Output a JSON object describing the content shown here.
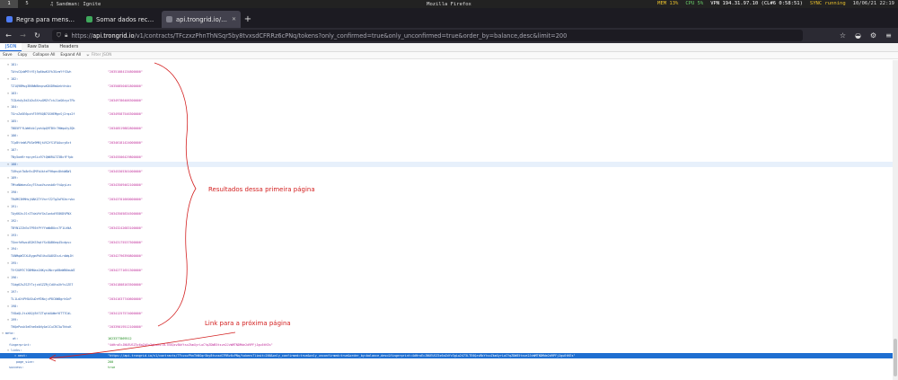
{
  "system_bar": {
    "workspaces": [
      "1",
      "5"
    ],
    "now_playing": "Sandman: Ignite",
    "window_title": "Mozilla Firefox",
    "stats": [
      {
        "label": "MEM",
        "value": "13%"
      },
      {
        "label": "CPU",
        "value": "5%"
      },
      {
        "label": "VPN",
        "value": "194.31.97.10 (CL#6 0:58:51)"
      },
      {
        "label": "SYNC",
        "value": "running"
      }
    ],
    "datetime": "10/06/21 22:19",
    "colors": {
      "mem": "#e9c12d",
      "cpu": "#6bd06b",
      "vpn": "#ffffff",
      "sync": "#e9c12d"
    }
  },
  "browser": {
    "tabs": [
      {
        "label": "Regra para mensagens...",
        "favicon": "#4e7cf5"
      },
      {
        "label": "Somar dados recupera...",
        "favicon": "#3fa85c"
      },
      {
        "label": "api.trongrid.io/v1/contra...",
        "favicon": "#7f7f8a"
      }
    ],
    "active_tab_index": 2,
    "new_tab_symbol": "+",
    "url": {
      "prefix": "https://",
      "host": "api.trongrid.io",
      "path": "/v1/contracts/TFczxzPhnThNSqr5by8tvxsdCFRRz6cPNq/tokens?only_confirmed=true&only_unconfirmed=true&order_by=balance,desc&limit=200"
    }
  },
  "viewer": {
    "tabs": [
      "JSON",
      "Raw Data",
      "Headers"
    ],
    "active_tab": "JSON",
    "actions": [
      "Save",
      "Copy",
      "Collapse All",
      "Expand All"
    ],
    "filter_placeholder": "Filter JSON"
  },
  "json": {
    "entries": [
      {
        "index": "181:",
        "address": "TAtsCQzWM7tfEj5p6bwKXYk3XzmYffZwh",
        "balance": "\"20351084134800000\""
      },
      {
        "index": "182:",
        "address": "TZ1Q9BMug3B6WW8eqcwKDXDRmAekthvbc",
        "balance": "\"20350850481800000\""
      },
      {
        "index": "183:",
        "address": "TCDzhAy3dZiDu3XrwGMZtTckJ1aG6xyxTFb",
        "balance": "\"20349786406300000\""
      },
      {
        "index": "184:",
        "address": "TGrxZa5E6pzhF39F6QB7GSHEMgnSj2rqx2f",
        "balance": "\"20349587546300000\""
      },
      {
        "index": "185:",
        "address": "TBD5FFfLWeKdiCyoh4pQ9TBVr7HWqaXyZQh",
        "balance": "\"20348519882800000\""
      },
      {
        "index": "186:",
        "address": "TCpBtteWLPUGe9MKjkVX2fS1FAAucy6xt",
        "balance": "\"20346181424000000\""
      },
      {
        "index": "187:",
        "address": "TNy5om9rrqcyeSix97tQW6RA7Z3BxfFfpb",
        "balance": "\"20345506429800000\""
      },
      {
        "index": "188:",
        "address": "TXRsyh7b8n9cZMFk4kteF9Hqec8hhW8W1",
        "balance": "\"20345305301000000\""
      },
      {
        "index": "189:",
        "address": "TMtaNWoeuGsyTShuoVsvosb6rYtApyLec",
        "balance": "\"20343509462100000\""
      },
      {
        "index": "190:",
        "address": "TRAMS3HMHsjNAKZ7YVnrfZ2TgZoFKXnrvbc",
        "balance": "\"20343701660000000\""
      },
      {
        "index": "191:",
        "address": "TAyKKXcJSrZTdaVhYGsCwnkdYE8KDVPNX",
        "balance": "\"20343505834500000\""
      },
      {
        "index": "192:",
        "address": "TBYN1ZJhEo7PE6tPfYYaWbBUcv7F1LhNA",
        "balance": "\"20343242683100000\""
      },
      {
        "index": "193:",
        "address": "TGnnfd9woiB2KS9qtYSc8AB6eq45cdpvc",
        "balance": "\"20343175537500000\""
      },
      {
        "index": "194:",
        "address": "TUNMqWCEXLBygmPkE4hu5A8SEvzLrdWqJH",
        "balance": "\"20342796390800000\""
      },
      {
        "index": "195:",
        "address": "TVf2UM7C7GBMNas1NKysXNcrp6BeWB6muWZ",
        "balance": "\"20342771651300000\""
      },
      {
        "index": "196:",
        "address": "TSdg6ZsZSZYTzjxkSZZRjCdUtoXhYs1ZE7",
        "balance": "\"20341808163500000\""
      },
      {
        "index": "197:",
        "address": "TL1LdXtPH5A5uDrM3NxjvP8C6WBgrhGnP",
        "balance": "\"20341637740600000\""
      },
      {
        "index": "198:",
        "address": "TVDaQLJtzX6QjBtTZTqtbUAWef6TTTCdL",
        "balance": "\"20341257574000000\""
      },
      {
        "index": "199:",
        "address": "THQePosk5eEhe6eAHyAe1CuCRC5wThhoK",
        "balance": "\"20339019512100000\""
      }
    ],
    "meta_label": "meta:",
    "at_label": "at:",
    "at_value": "1623377869512",
    "fingerprint_label": "fingerprint:",
    "fingerprint_value": "\"4dHroEcJNUEUSZ5z6aZdYv3gLw2473LTE0QzvBbYtsxZkmXyrLoCYqZDW85tsve2JvWMTNDMde2d9PFjJgu6tKEs\"",
    "links_label": "links:",
    "next_label": "next:",
    "next_value": "\"https://api.trongrid.io/v1/contracts/TFczxzPhnThNSqr5by8tvxsdCFRRz6cPNq/tokens?limit=200&only_confirmed=true&only_unconfirmed=true&order_by=balance,desc&fingerprint=4dHroEcJNUEUSZ5z6aZdYv3gLw2473LTE0QzvBbYtsxZkmXyrLoCYqZDW85tsve2JvWMTNDMde2d9PFjJgu6tKEs\"",
    "page_size_label": "page_size:",
    "page_size_value": "200",
    "success_label": "success:",
    "success_value": "true"
  },
  "annotations": {
    "results_text": "Resultados dessa primeira página",
    "next_link_text": "Link para a próxima página",
    "color": "#d32020"
  }
}
